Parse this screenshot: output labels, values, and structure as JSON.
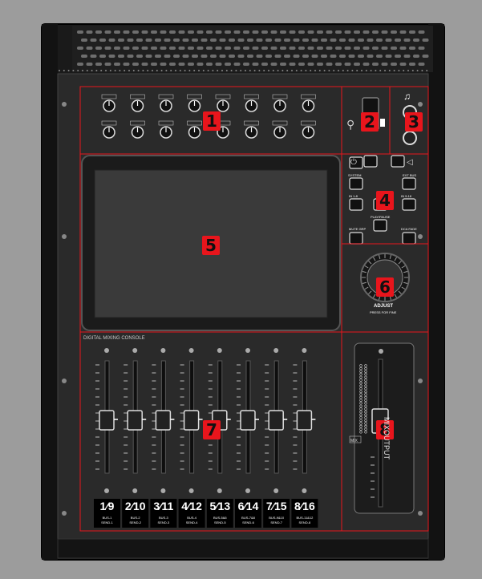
{
  "console_label": "DIGITAL MIXING CONSOLE",
  "badges": [
    "1",
    "2",
    "3",
    "4",
    "5",
    "6",
    "7",
    "8"
  ],
  "mix_output_label": "MIXOUTPUT",
  "mix_output_meter_label": "MIX",
  "adjust_label": "ADJUST",
  "adjust_sub": "PRESS FOR FINE",
  "buttons": {
    "system": "SYSTEM",
    "ext_bus": "EXT BUS",
    "in1_8": "IN 1-8",
    "in9_16": "IN 9-16",
    "play_pause": "PLAY/PAUSE",
    "mute_grp": "MUTE GRP",
    "dca": "DCA FADE"
  },
  "channel_strips": [
    {
      "num": "1",
      "alt": "9",
      "bus": "BUS-1",
      "send": "SEND-1"
    },
    {
      "num": "2",
      "alt": "10",
      "bus": "BUS-2",
      "send": "SEND-2"
    },
    {
      "num": "3",
      "alt": "11",
      "bus": "BUS-3",
      "send": "SEND-3"
    },
    {
      "num": "4",
      "alt": "12",
      "bus": "BUS-4",
      "send": "SEND-4"
    },
    {
      "num": "5",
      "alt": "13",
      "bus": "BUS-5&6",
      "send": "SEND-5"
    },
    {
      "num": "6",
      "alt": "14",
      "bus": "BUS-7&8",
      "send": "SEND-6"
    },
    {
      "num": "7",
      "alt": "15",
      "bus": "BUS-9&10",
      "send": "SEND-7"
    },
    {
      "num": "8",
      "alt": "16",
      "bus": "BUS-11&12",
      "send": "SEND-8"
    }
  ],
  "colors": {
    "background": "#9c9c9c",
    "panel": "#2a2a2a",
    "zone_outline": "#e8151c",
    "badge": "#e8151c"
  }
}
